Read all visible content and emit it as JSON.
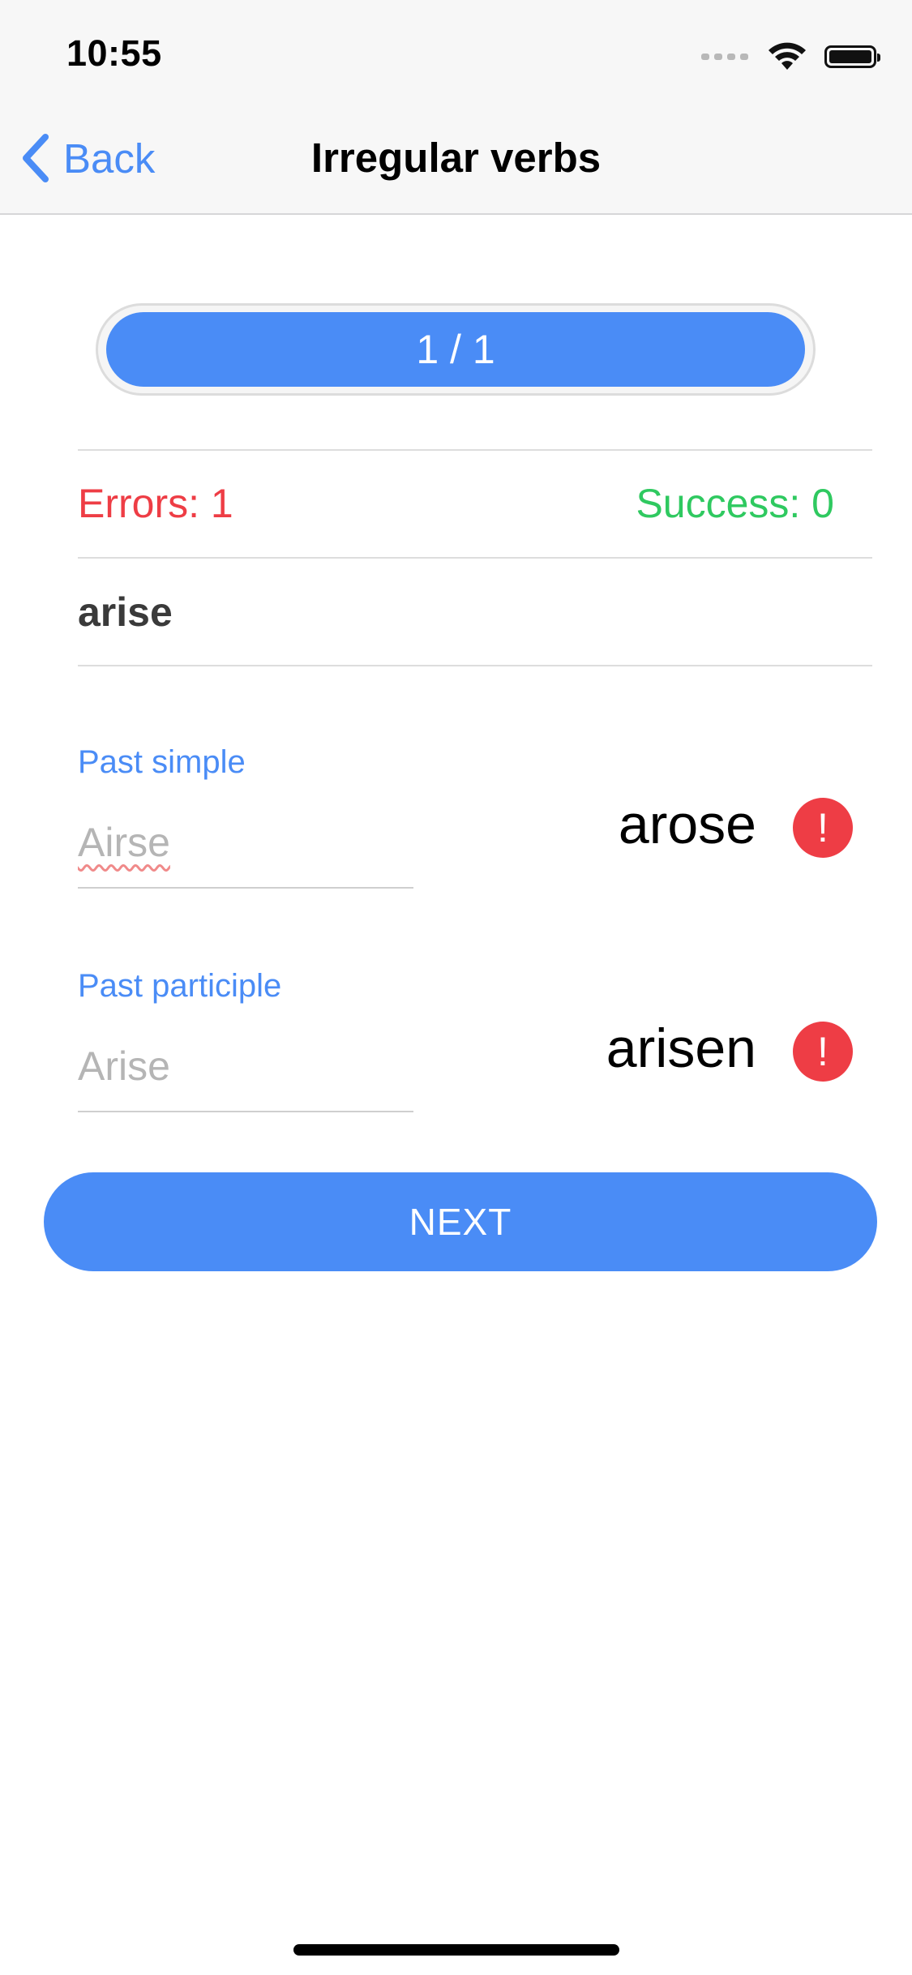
{
  "status_bar": {
    "time": "10:55",
    "signal_icon": "signal-dots-icon",
    "wifi_icon": "wifi-icon",
    "battery_icon": "battery-icon"
  },
  "nav": {
    "back_icon": "chevron-left-icon",
    "back_label": "Back",
    "title": "Irregular verbs"
  },
  "progress": {
    "label": "1 / 1",
    "fraction": 1.0
  },
  "score": {
    "errors_label": "Errors: 1",
    "success_label": "Success: 0"
  },
  "verb": {
    "base": "arise"
  },
  "fields": [
    {
      "label": "Past simple",
      "value": "Airse",
      "correct_answer": "arose",
      "status_icon": "exclamation-circle-icon"
    },
    {
      "label": "Past participle",
      "value": "Arise",
      "correct_answer": "arisen",
      "status_icon": "exclamation-circle-icon"
    }
  ],
  "next_button": {
    "label": "NEXT"
  },
  "colors": {
    "accent": "#4a8cf6",
    "error": "#ee3d45",
    "success": "#2fc960"
  }
}
